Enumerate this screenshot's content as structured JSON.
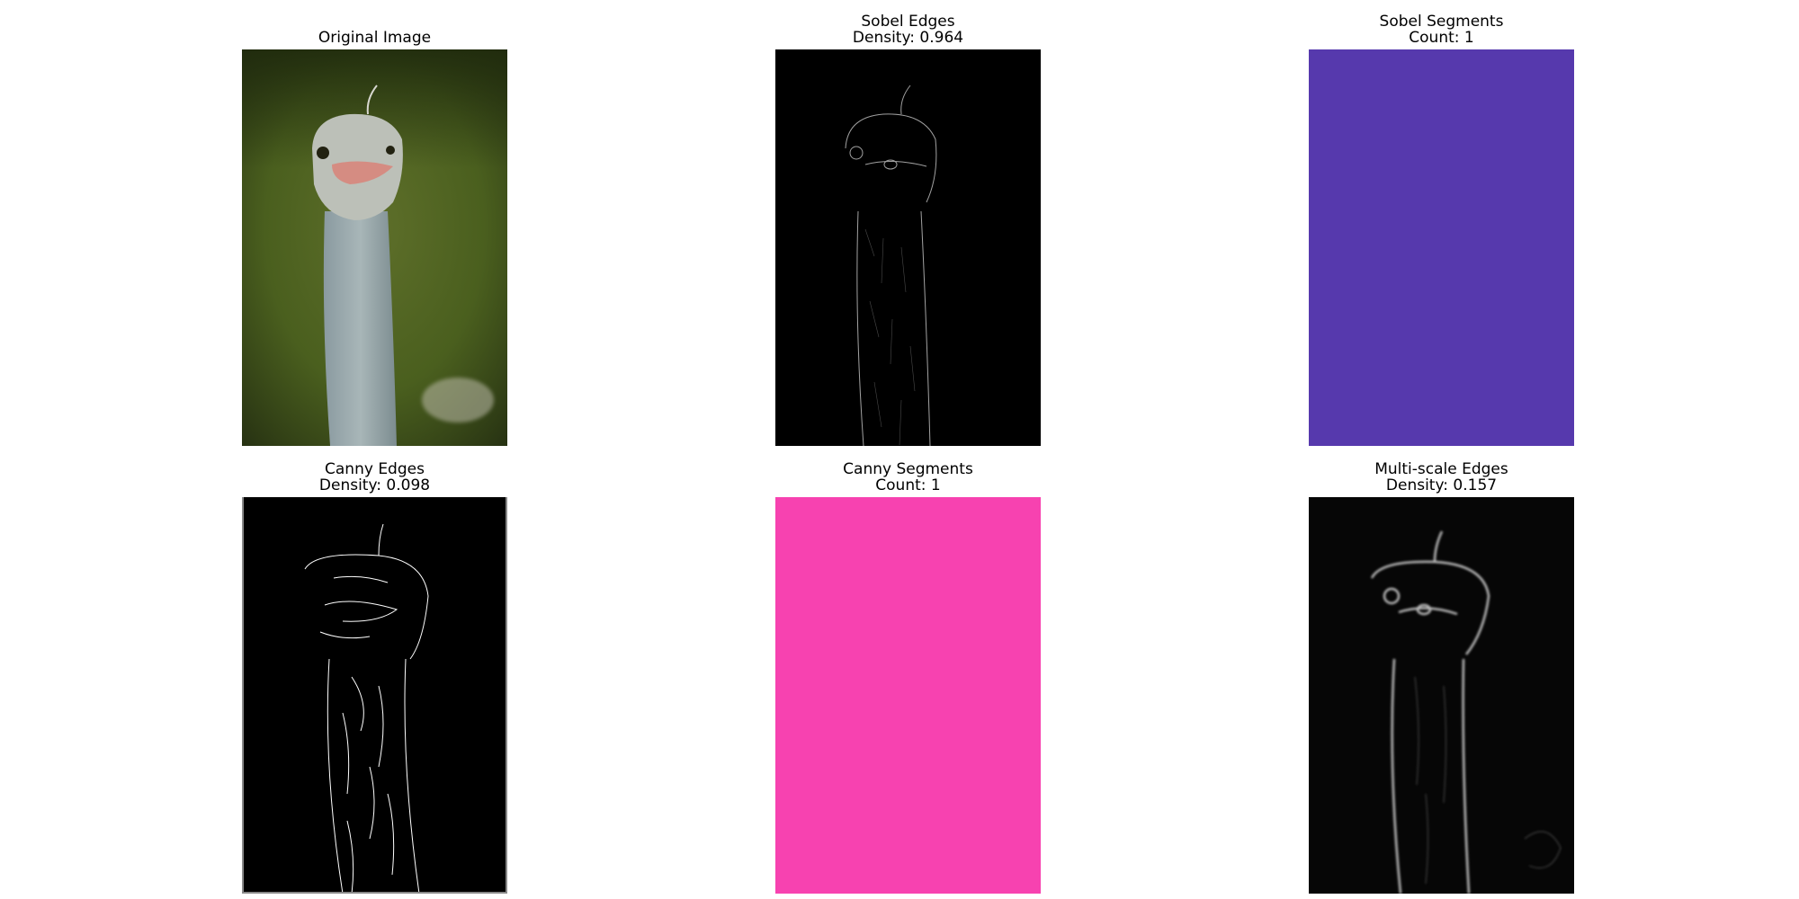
{
  "figure": {
    "panels": [
      {
        "id": "original",
        "title": [
          "Original Image"
        ],
        "kind": "photo"
      },
      {
        "id": "sobel-edges",
        "title": [
          "Sobel Edges",
          "Density: 0.964"
        ],
        "kind": "edges-soft"
      },
      {
        "id": "sobel-segments",
        "title": [
          "Sobel Segments",
          "Count: 1"
        ],
        "kind": "solid",
        "color": "#5639ad"
      },
      {
        "id": "canny-edges",
        "title": [
          "Canny Edges",
          "Density: 0.098"
        ],
        "kind": "edges-canny"
      },
      {
        "id": "canny-segments",
        "title": [
          "Canny Segments",
          "Count: 1"
        ],
        "kind": "solid",
        "color": "#f742b0"
      },
      {
        "id": "multiscale-edges",
        "title": [
          "Multi-scale Edges",
          "Density: 0.157"
        ],
        "kind": "edges-blur"
      }
    ]
  }
}
